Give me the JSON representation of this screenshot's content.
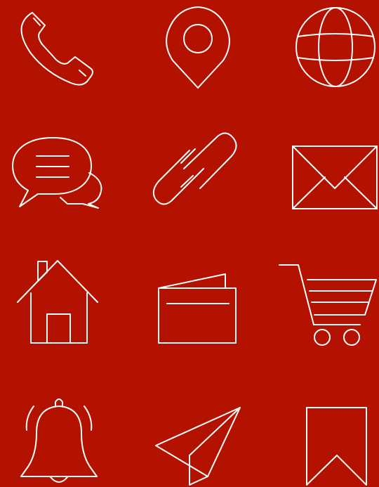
{
  "theme": {
    "background": "#b31200",
    "stroke": "#ffffff"
  },
  "icons": [
    "phone-icon",
    "location-pin-icon",
    "globe-icon",
    "chat-bubbles-icon",
    "link-icon",
    "envelope-icon",
    "home-icon",
    "wallet-icon",
    "shopping-cart-icon",
    "bell-icon",
    "paper-plane-icon",
    "bookmark-icon"
  ]
}
